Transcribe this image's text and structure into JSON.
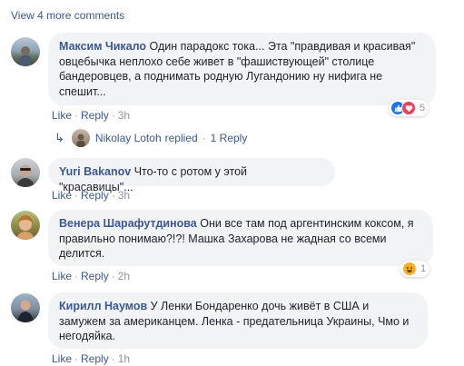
{
  "view_more": "View 4 more comments",
  "actions": {
    "like": "Like",
    "reply": "Reply",
    "sep": "·"
  },
  "comments": [
    {
      "author": "Максим Чикало",
      "text": "Один парадокс тока... Эта \"правдивая и красивая\" овцебычка неплохо себе живет в \"фашиствующей\" столице бандеровцев, а поднимать родную Лугандонию ну нифига не спешит...",
      "time": "3h",
      "reactions": {
        "icons": [
          "like-icon",
          "love-icon"
        ],
        "count": "5"
      }
    },
    {
      "author": "Yuri Bakanov",
      "text": "Что-то с ротом у этой \"красавицы\"...",
      "time": "3h"
    },
    {
      "author": "Венера Шарафутдинова",
      "text": "Они все там под аргентинским коксом, я правильно понимаю?!?! Машка Захарова не жадная со всеми делится.",
      "time": "2h",
      "reactions": {
        "icons": [
          "haha-icon"
        ],
        "count": "1"
      }
    },
    {
      "author": "Кирилл Наумов",
      "text": "У Ленки Бондаренко дочь живёт в США и замужем за американцем. Ленка - предательница Украины, Чмо и негодяйка.",
      "time": "1h"
    }
  ],
  "reply_row": {
    "author": "Nikolay Lotoh",
    "label": "replied",
    "count": "1 Reply"
  },
  "colors": {
    "link": "#385898",
    "bubble": "#f2f3f5",
    "meta": "#90949c",
    "like": "#1877f2",
    "love": "#f33e58",
    "haha": "#f7b125"
  }
}
